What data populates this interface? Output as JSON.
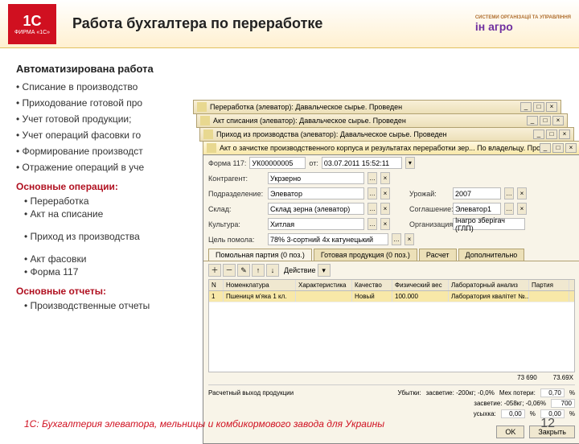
{
  "header": {
    "title": "Работа бухгалтера по переработке",
    "logo1c_top": "1С",
    "logo1c_bottom": "ФИРМА «1С»",
    "logo_right": "ін агро",
    "logo_right_sub": "СИСТЕМИ ОРГАНІЗАЦІЇ ТА УПРАВЛІННЯ"
  },
  "left": {
    "subtitle": "Автоматизирована работa",
    "bullets": [
      "• Списание в производство",
      "• Приходование готовой про",
      "• Учет готовой продукции;",
      "• Учет операций фасовки го",
      "• Формирование производст",
      "• Отражение операций в уче"
    ],
    "ops_h": "Основные операции:",
    "ops": [
      "• Переработка",
      "• Акт на списание",
      "• Приход из производства",
      "• Акт фасовки",
      "• Форма 117"
    ],
    "rep_h": "Основные отчеты:",
    "reps": [
      "• Производственные отчеты"
    ]
  },
  "stack_titles": [
    "Переработка (элеватор): Давальческое сырье. Проведен",
    "Акт списания (элеватор): Давальческое сырье. Проведен",
    "Приход из производства (элеватор): Давальческое сырье. Проведен",
    "Акт о зачистке производственного корпуса и результатах переработки зер...  По владельцу. Проведен"
  ],
  "form": {
    "form_label": "Форма 117:",
    "form_no": "УК00000005",
    "from": "от:",
    "date": "03.07.2011 15:52:11",
    "contractor_label": "Контрагент:",
    "contractor": "Укрзерно",
    "subdiv_label": "Подразделение:",
    "subdiv": "Элеватор",
    "harvest_label": "Урожай:",
    "harvest": "2007",
    "storage_label": "Склад:",
    "storage": "Склад зерна (элеватор)",
    "owner_label": "Соглашение:",
    "owner": "Элеватор1",
    "org_label": "Организация:",
    "org": "Інагро зберігач (ГЛП)",
    "culture_label": "Культура:",
    "culture": "Хитлая",
    "goal_label": "Цель помола:",
    "goal": "78% 3-сортний 4х катунецький"
  },
  "tabs": [
    "Помольная партия (0 поз.)",
    "Готовая продукция (0 поз.)",
    "Расчет",
    "Дополнительно"
  ],
  "toolbar": {
    "action_label": "Действие"
  },
  "grid": {
    "headers": [
      "N",
      "Номенклатура",
      "Характеристика",
      "Качество",
      "Физический вес",
      "Лабораторный анализ",
      "Партия"
    ],
    "row": [
      "1",
      "Пшениця м'яка 1 кл.",
      "",
      "Новый",
      "100.000",
      "Лаборатория квалітет №...",
      ""
    ]
  },
  "totals": {
    "w1": "73 690",
    "w2": "73.69X"
  },
  "summary": {
    "h": "Расчетный выход продукции",
    "r1_label": "Убытки:",
    "r1_a": "засветие: -200кг; -0,0%",
    "r1_b": "Мех потери:",
    "r1_b_val": "0,70",
    "r1_b_unit": "%",
    "r2_a": "засветие: -058кг; -0,06%",
    "r2_b_val": "700",
    "r3_a": "усыхка:",
    "r3_a_val": "0,00",
    "r3_a_unit": "%",
    "r3_b_val": "0,00",
    "r3_b_unit": "%"
  },
  "actions": {
    "ok": "OK",
    "close": "Закрыть"
  },
  "footer": {
    "text": "1С: Бухгалтерия элеватора, мельницы и комбикормового завода для Украины",
    "page": "12"
  }
}
